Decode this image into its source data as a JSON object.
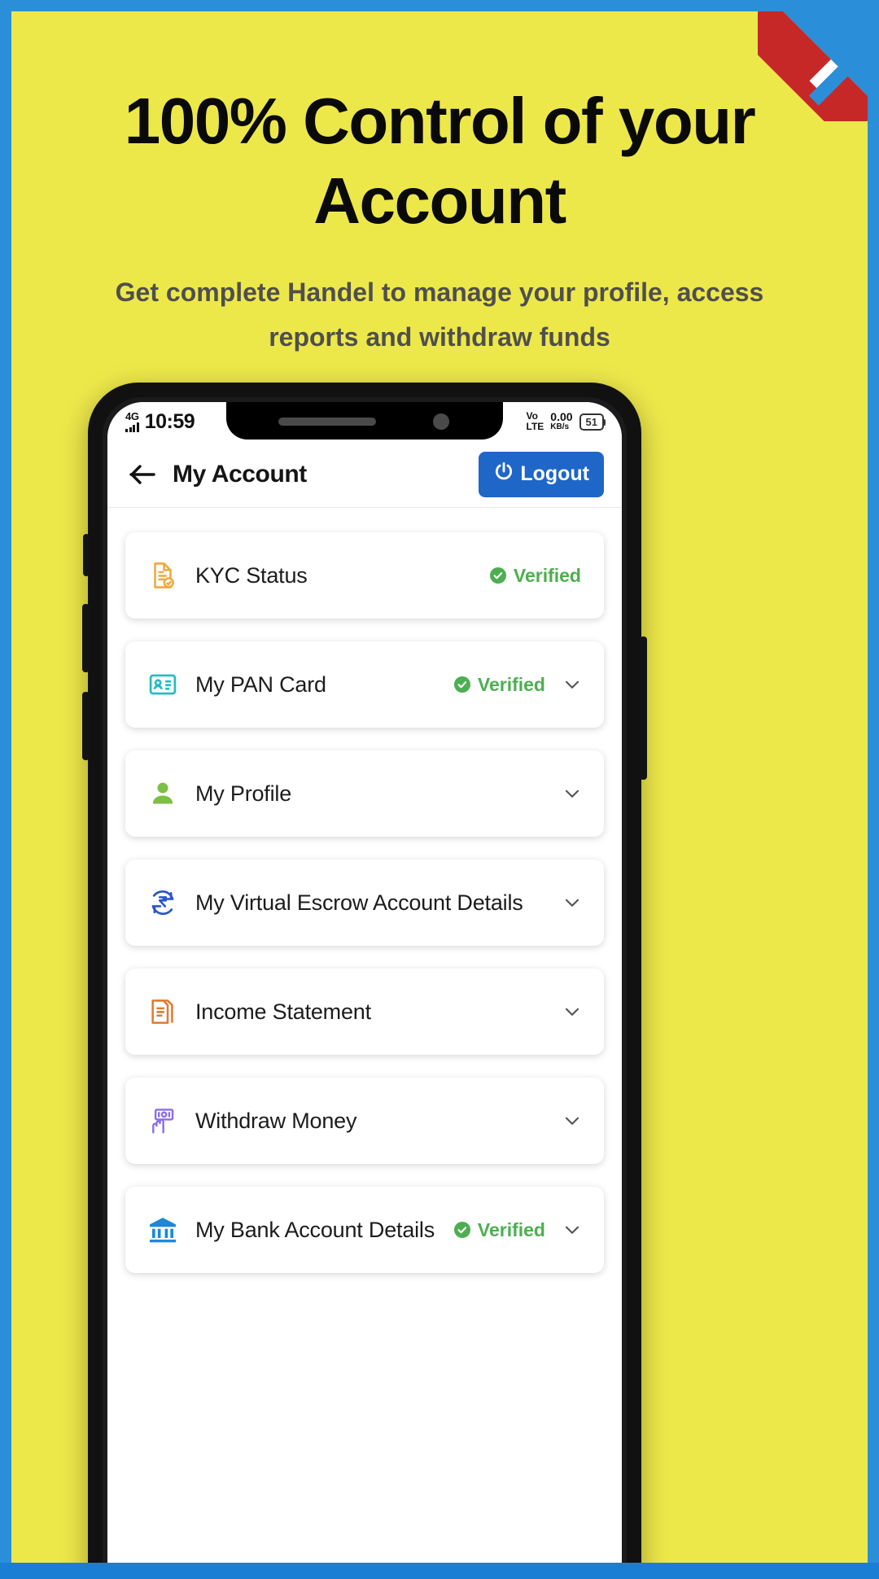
{
  "banner": {
    "headline": "100% Control of your Account",
    "subtitle": "Get complete Handel to manage your profile, access reports and withdraw funds",
    "bg_color": "#EDE84A",
    "border_color": "#2a8fd8",
    "accent_red": "#c62828"
  },
  "status_bar": {
    "network": "4G",
    "time": "10:59",
    "volte_line1": "Vo",
    "volte_line2": "LTE",
    "data_rate": "0.00",
    "data_unit": "KB/s",
    "battery": "51"
  },
  "app_bar": {
    "title": "My Account",
    "logout_label": "Logout",
    "logout_color": "#1f66c9"
  },
  "verified_color": "#4CAF50",
  "items": [
    {
      "label": "KYC Status",
      "icon": "kyc-document-icon",
      "status": "Verified",
      "chevron": false
    },
    {
      "label": "My PAN Card",
      "icon": "id-card-icon",
      "status": "Verified",
      "chevron": true
    },
    {
      "label": "My Profile",
      "icon": "person-icon",
      "status": "",
      "chevron": true
    },
    {
      "label": "My Virtual Escrow Account Details",
      "icon": "rupee-refresh-icon",
      "status": "",
      "chevron": true
    },
    {
      "label": "Income Statement",
      "icon": "statement-icon",
      "status": "",
      "chevron": true
    },
    {
      "label": "Withdraw Money",
      "icon": "cash-hand-icon",
      "status": "",
      "chevron": true
    },
    {
      "label": "My Bank Account Details",
      "icon": "bank-icon",
      "status": "Verified",
      "chevron": true
    }
  ]
}
